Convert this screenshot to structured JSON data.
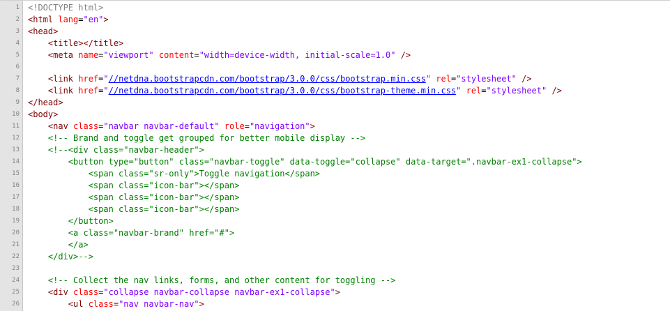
{
  "editor": {
    "lines": [
      {
        "n": "1",
        "indent": "",
        "tokens": [
          [
            "doc",
            "<!DOCTYPE html>"
          ]
        ]
      },
      {
        "n": "2",
        "indent": "",
        "tokens": [
          [
            "tag",
            "<html "
          ],
          [
            "attr",
            "lang"
          ],
          [
            "eq",
            "="
          ],
          [
            "val",
            "\"en\""
          ],
          [
            "tag",
            ">"
          ]
        ]
      },
      {
        "n": "3",
        "indent": "",
        "tokens": [
          [
            "tag",
            "<head>"
          ]
        ]
      },
      {
        "n": "4",
        "indent": "    ",
        "tokens": [
          [
            "tag",
            "<title></title>"
          ]
        ]
      },
      {
        "n": "5",
        "indent": "    ",
        "tokens": [
          [
            "tag",
            "<meta "
          ],
          [
            "attr",
            "name"
          ],
          [
            "eq",
            "="
          ],
          [
            "val",
            "\"viewport\""
          ],
          [
            "tag",
            " "
          ],
          [
            "attr",
            "content"
          ],
          [
            "eq",
            "="
          ],
          [
            "val",
            "\"width=device-width, initial-scale=1.0\""
          ],
          [
            "tag",
            " />"
          ]
        ]
      },
      {
        "n": "6",
        "indent": "",
        "tokens": []
      },
      {
        "n": "7",
        "indent": "    ",
        "tokens": [
          [
            "tag",
            "<link "
          ],
          [
            "attr",
            "href"
          ],
          [
            "eq",
            "="
          ],
          [
            "val",
            "\""
          ],
          [
            "link",
            "//netdna.bootstrapcdn.com/bootstrap/3.0.0/css/bootstrap.min.css"
          ],
          [
            "val",
            "\""
          ],
          [
            "tag",
            " "
          ],
          [
            "attr",
            "rel"
          ],
          [
            "eq",
            "="
          ],
          [
            "val",
            "\"stylesheet\""
          ],
          [
            "tag",
            " />"
          ]
        ]
      },
      {
        "n": "8",
        "indent": "    ",
        "tokens": [
          [
            "tag",
            "<link "
          ],
          [
            "attr",
            "href"
          ],
          [
            "eq",
            "="
          ],
          [
            "val",
            "\""
          ],
          [
            "link",
            "//netdna.bootstrapcdn.com/bootstrap/3.0.0/css/bootstrap-theme.min.css"
          ],
          [
            "val",
            "\""
          ],
          [
            "tag",
            " "
          ],
          [
            "attr",
            "rel"
          ],
          [
            "eq",
            "="
          ],
          [
            "val",
            "\"stylesheet\""
          ],
          [
            "tag",
            " />"
          ]
        ]
      },
      {
        "n": "9",
        "indent": "",
        "tokens": [
          [
            "tag",
            "</head>"
          ]
        ]
      },
      {
        "n": "10",
        "indent": "",
        "tokens": [
          [
            "tag",
            "<body>"
          ]
        ]
      },
      {
        "n": "11",
        "indent": "    ",
        "tokens": [
          [
            "tag",
            "<nav "
          ],
          [
            "attr",
            "class"
          ],
          [
            "eq",
            "="
          ],
          [
            "val",
            "\"navbar navbar-default\""
          ],
          [
            "tag",
            " "
          ],
          [
            "attr",
            "role"
          ],
          [
            "eq",
            "="
          ],
          [
            "val",
            "\"navigation\""
          ],
          [
            "tag",
            ">"
          ]
        ]
      },
      {
        "n": "12",
        "indent": "    ",
        "tokens": [
          [
            "com",
            "<!-- Brand and toggle get grouped for better mobile display -->"
          ]
        ]
      },
      {
        "n": "13",
        "indent": "    ",
        "tokens": [
          [
            "com",
            "<!--<div class=\"navbar-header\">"
          ]
        ]
      },
      {
        "n": "14",
        "indent": "        ",
        "tokens": [
          [
            "com",
            "<button type=\"button\" class=\"navbar-toggle\" data-toggle=\"collapse\" data-target=\".navbar-ex1-collapse\">"
          ]
        ]
      },
      {
        "n": "15",
        "indent": "            ",
        "tokens": [
          [
            "com",
            "<span class=\"sr-only\">Toggle navigation</span>"
          ]
        ]
      },
      {
        "n": "16",
        "indent": "            ",
        "tokens": [
          [
            "com",
            "<span class=\"icon-bar\"></span>"
          ]
        ]
      },
      {
        "n": "17",
        "indent": "            ",
        "tokens": [
          [
            "com",
            "<span class=\"icon-bar\"></span>"
          ]
        ]
      },
      {
        "n": "18",
        "indent": "            ",
        "tokens": [
          [
            "com",
            "<span class=\"icon-bar\"></span>"
          ]
        ]
      },
      {
        "n": "19",
        "indent": "        ",
        "tokens": [
          [
            "com",
            "</button>"
          ]
        ]
      },
      {
        "n": "20",
        "indent": "        ",
        "tokens": [
          [
            "com",
            "<a class=\"navbar-brand\" href=\"#\">"
          ]
        ]
      },
      {
        "n": "21",
        "indent": "        ",
        "tokens": [
          [
            "com",
            "</a>"
          ]
        ]
      },
      {
        "n": "22",
        "indent": "    ",
        "tokens": [
          [
            "com",
            "</div>-->"
          ]
        ]
      },
      {
        "n": "23",
        "indent": "",
        "tokens": []
      },
      {
        "n": "24",
        "indent": "    ",
        "tokens": [
          [
            "com",
            "<!-- Collect the nav links, forms, and other content for toggling -->"
          ]
        ]
      },
      {
        "n": "25",
        "indent": "    ",
        "tokens": [
          [
            "tag",
            "<div "
          ],
          [
            "attr",
            "class"
          ],
          [
            "eq",
            "="
          ],
          [
            "val",
            "\"collapse navbar-collapse navbar-ex1-collapse\""
          ],
          [
            "tag",
            ">"
          ]
        ]
      },
      {
        "n": "26",
        "indent": "        ",
        "tokens": [
          [
            "tag",
            "<ul "
          ],
          [
            "attr",
            "class"
          ],
          [
            "eq",
            "="
          ],
          [
            "val",
            "\"nav navbar-nav\""
          ],
          [
            "tag",
            ">"
          ]
        ]
      }
    ],
    "colors": {
      "gutter": "#e4e4e4",
      "tag": "#800000",
      "attr": "#ff0000",
      "value": "#8000ff",
      "comment": "#008000",
      "doctype": "#808080",
      "link": "#0000ff"
    }
  }
}
